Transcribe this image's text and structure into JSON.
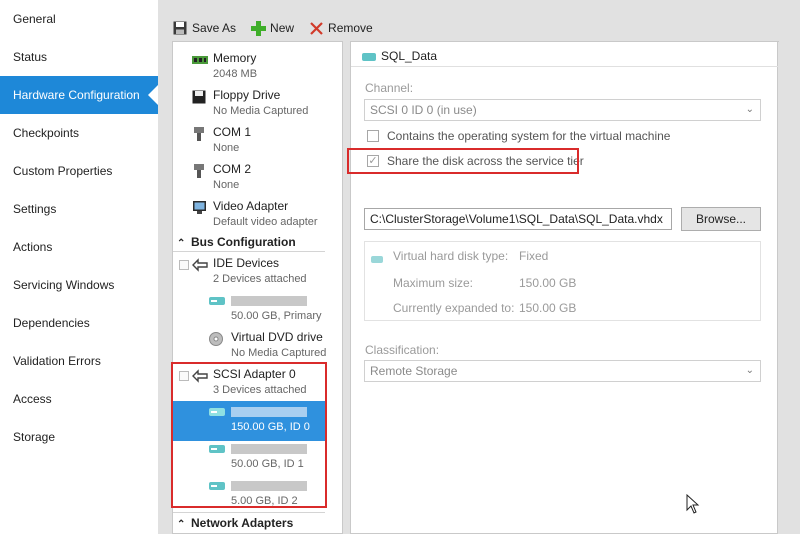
{
  "nav": {
    "items": [
      {
        "label": "General",
        "name": "nav-general"
      },
      {
        "label": "Status",
        "name": "nav-status"
      },
      {
        "label": "Hardware Configuration",
        "name": "nav-hardware-configuration",
        "selected": true
      },
      {
        "label": "Checkpoints",
        "name": "nav-checkpoints"
      },
      {
        "label": "Custom Properties",
        "name": "nav-custom-properties"
      },
      {
        "label": "Settings",
        "name": "nav-settings"
      },
      {
        "label": "Actions",
        "name": "nav-actions"
      },
      {
        "label": "Servicing Windows",
        "name": "nav-servicing-windows"
      },
      {
        "label": "Dependencies",
        "name": "nav-dependencies"
      },
      {
        "label": "Validation Errors",
        "name": "nav-validation-errors"
      },
      {
        "label": "Access",
        "name": "nav-access"
      },
      {
        "label": "Storage",
        "name": "nav-storage"
      }
    ]
  },
  "toolbar": {
    "save_as": "Save As",
    "new": "New",
    "remove": "Remove"
  },
  "devices": {
    "memory": {
      "name": "Memory",
      "sub": "2048 MB"
    },
    "floppy": {
      "name": "Floppy Drive",
      "sub": "No Media Captured"
    },
    "com1": {
      "name": "COM 1",
      "sub": "None"
    },
    "com2": {
      "name": "COM 2",
      "sub": "None"
    },
    "video": {
      "name": "Video Adapter",
      "sub": "Default video adapter"
    },
    "bus_header": "Bus Configuration",
    "ide": {
      "name": "IDE Devices",
      "sub": "2 Devices attached"
    },
    "ide_disk": {
      "sub": "50.00 GB, Primary"
    },
    "dvd": {
      "name": "Virtual DVD drive",
      "sub": "No Media Captured"
    },
    "scsi": {
      "name": "SCSI Adapter 0",
      "sub": "3 Devices attached"
    },
    "scsi_disk0": {
      "sub": "150.00 GB, ID 0"
    },
    "scsi_disk1": {
      "sub": "50.00 GB, ID 1"
    },
    "scsi_disk2": {
      "sub": "5.00 GB, ID 2"
    },
    "net_header": "Network Adapters"
  },
  "props": {
    "title": "SQL_Data",
    "channel_label": "Channel:",
    "channel_value": "SCSI 0 ID 0 (in use)",
    "os_checkbox": "Contains the operating system for the virtual machine",
    "share_checkbox": "Share the disk across the service tier",
    "share_checked": true,
    "path": "C:\\ClusterStorage\\Volume1\\SQL_Data\\SQL_Data.vhdx",
    "browse": "Browse...",
    "vhd_type_label": "Virtual hard disk type:",
    "vhd_type_value": "Fixed",
    "max_size_label": "Maximum size:",
    "max_size_value": "150.00 GB",
    "expanded_label": "Currently expanded to:",
    "expanded_value": "150.00 GB",
    "classification_label": "Classification:",
    "classification_value": "Remote Storage"
  },
  "colors": {
    "accent": "#1e88d8",
    "highlight": "#d92b2b"
  }
}
